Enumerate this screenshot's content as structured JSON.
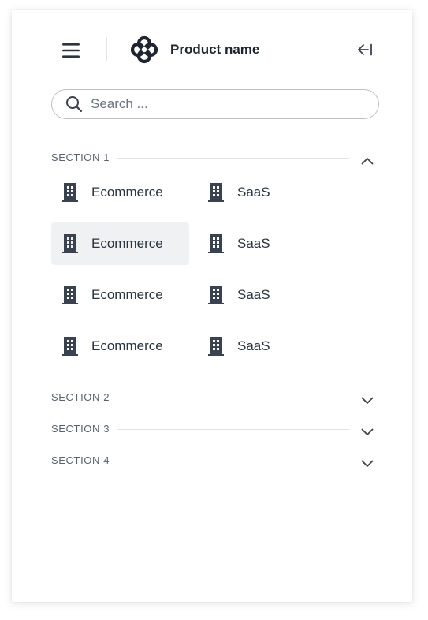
{
  "header": {
    "product_name": "Product name",
    "menu_icon": "hamburger-menu-icon",
    "logo_icon": "flower-logo-icon",
    "collapse_icon": "collapse-left-icon"
  },
  "search": {
    "placeholder": "Search ...",
    "value": "",
    "icon": "search-icon"
  },
  "sections": [
    {
      "label": "SECTION 1",
      "expanded": true,
      "items": [
        {
          "label": "Ecommerce",
          "icon": "building-icon",
          "active": false
        },
        {
          "label": "SaaS",
          "icon": "building-icon",
          "active": false
        },
        {
          "label": "Ecommerce",
          "icon": "building-icon",
          "active": true
        },
        {
          "label": "SaaS",
          "icon": "building-icon",
          "active": false
        },
        {
          "label": "Ecommerce",
          "icon": "building-icon",
          "active": false
        },
        {
          "label": "SaaS",
          "icon": "building-icon",
          "active": false
        },
        {
          "label": "Ecommerce",
          "icon": "building-icon",
          "active": false
        },
        {
          "label": "SaaS",
          "icon": "building-icon",
          "active": false
        }
      ]
    },
    {
      "label": "SECTION 2",
      "expanded": false
    },
    {
      "label": "SECTION 3",
      "expanded": false
    },
    {
      "label": "SECTION 4",
      "expanded": false
    }
  ],
  "colors": {
    "text": "#2b3441",
    "muted": "#5a6270",
    "active_bg": "#f0f1f3",
    "divider": "#dfe2e6",
    "icon": "#3a4250"
  }
}
